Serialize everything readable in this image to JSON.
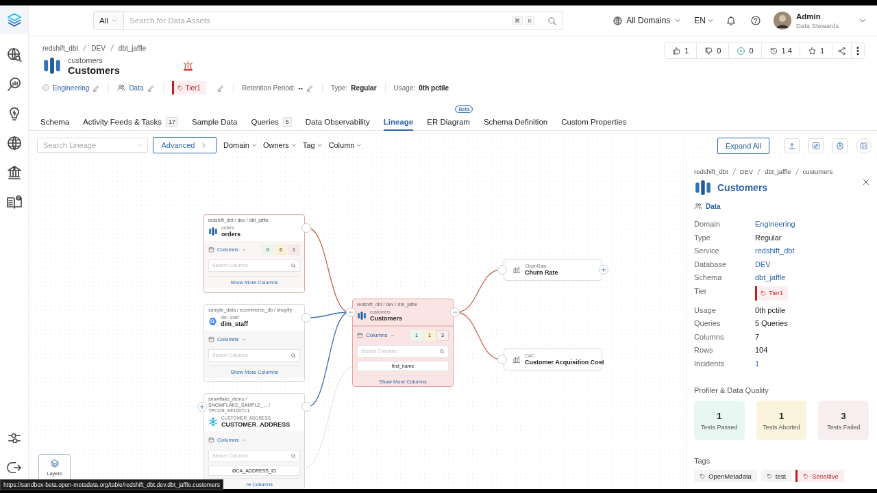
{
  "header": {
    "search_scope": "All",
    "search_placeholder": "Search for Data Assets",
    "shortcut_keys": [
      "⌘",
      "K"
    ],
    "domain": "All Domains",
    "language": "EN",
    "user": {
      "name": "Admin",
      "role": "Data Stewards"
    }
  },
  "breadcrumb": [
    "redshift_dbt",
    "DEV",
    "dbt_jaffle"
  ],
  "entity": {
    "name": "customers",
    "display_name": "Customers"
  },
  "actions": [
    {
      "kind": "like",
      "count": "1"
    },
    {
      "kind": "dislike",
      "count": "0"
    },
    {
      "kind": "watch",
      "count": "0"
    },
    {
      "kind": "version",
      "count": "1.4"
    },
    {
      "kind": "star",
      "count": "1"
    }
  ],
  "properties": {
    "domain": "Engineering",
    "owner": "Data",
    "tier": "Tier1",
    "fields": [
      {
        "label": "Retention Period:",
        "value": "--",
        "editable": true
      },
      {
        "label": "Type:",
        "value": "Regular",
        "editable": false
      },
      {
        "label": "Usage:",
        "value": "0th pctile",
        "editable": false
      }
    ]
  },
  "tabs": [
    {
      "label": "Schema",
      "selected": false
    },
    {
      "label": "Activity Feeds & Tasks",
      "count": "17",
      "selected": false
    },
    {
      "label": "Sample Data",
      "selected": false
    },
    {
      "label": "Queries",
      "count": "5",
      "selected": false
    },
    {
      "label": "Data Observability",
      "selected": false
    },
    {
      "label": "Lineage",
      "selected": true
    },
    {
      "label": "ER Diagram",
      "badge": "Beta",
      "selected": false
    },
    {
      "label": "Schema Definition",
      "selected": false
    },
    {
      "label": "Custom Properties",
      "selected": false
    }
  ],
  "lineage_toolbar": {
    "search_placeholder": "Search Lineage",
    "advanced": "Advanced",
    "filters": [
      "Domain",
      "Owners",
      "Tag",
      "Column"
    ],
    "expand_all": "Expand All"
  },
  "nodes": [
    {
      "kind": "table",
      "path": "redshift_dbt / dev / dbt_jaffle",
      "name": "orders",
      "display_name": "orders",
      "selected": false,
      "traced": true,
      "columns_label": "Columns",
      "column_counts": [
        "0",
        "6",
        "1"
      ],
      "search_placeholder": "Search Columns",
      "show_more": "Show More Columns"
    },
    {
      "kind": "table",
      "path": "sample_data / ecommerce_db / shopify",
      "name": "dim_staff",
      "display_name": "dim_staff",
      "selected": false,
      "traced": false,
      "columns_label": "Columns",
      "search_placeholder": "Search Columns",
      "show_more": "Show More Columns"
    },
    {
      "kind": "table",
      "path": "snowflake_demo / SNOWFLAKE_SAMPLE_... / TPCDS_SF100TCL",
      "name": "CUSTOMER_ADDRESS",
      "display_name": "CUSTOMER_ADDRESS",
      "selected": false,
      "traced": false,
      "columns_label": "Columns",
      "search_placeholder": "Search Columns",
      "columns": [
        {
          "name": "CA_ADDRESS_ID",
          "symbol": "Ø"
        }
      ],
      "show_more": "re Columns"
    },
    {
      "kind": "table",
      "path": "redshift_dbt / dev / dbt_jaffle",
      "name": "customers",
      "display_name": "Customers",
      "selected": true,
      "traced": false,
      "columns_label": "Columns",
      "column_counts": [
        "1",
        "1",
        "3"
      ],
      "search_placeholder": "Search Columns",
      "columns": [
        {
          "name": "first_name"
        }
      ],
      "show_more": "Show More Columns"
    },
    {
      "kind": "metric",
      "name": "ChurnRate",
      "display_name": "Churn Rate"
    },
    {
      "kind": "metric",
      "name": "CAC",
      "display_name": "Customer Acquisition Cost"
    }
  ],
  "edges": [
    {
      "kind": "table",
      "color": "#c4664d"
    },
    {
      "kind": "table",
      "color": "#3f6fae"
    },
    {
      "kind": "table",
      "color": "#3f6fae"
    },
    {
      "kind": "table",
      "color": "#c4664d"
    },
    {
      "kind": "table",
      "color": "#c4664d"
    },
    {
      "kind": "column",
      "color": "#e2e2e2"
    }
  ],
  "layers": "Layers",
  "panel": {
    "breadcrumb": [
      "redshift_dbt",
      "DEV",
      "dbt_jaffle",
      "customers"
    ],
    "title": "Customers",
    "owner": "Data",
    "details": [
      {
        "label": "Domain",
        "value": "Engineering",
        "kind": "link"
      },
      {
        "label": "Type",
        "value": "Regular",
        "kind": "text"
      },
      {
        "label": "Service",
        "value": "redshift_dbt",
        "kind": "link"
      },
      {
        "label": "Database",
        "value": "DEV",
        "kind": "link"
      },
      {
        "label": "Schema",
        "value": "dbt_jaffle",
        "kind": "link"
      },
      {
        "label": "Tier",
        "value": "Tier1",
        "kind": "tier"
      },
      {
        "label": "Usage",
        "value": "0th pctile",
        "kind": "text"
      },
      {
        "label": "Queries",
        "value": "5 Queries",
        "kind": "text"
      },
      {
        "label": "Columns",
        "value": "7",
        "kind": "text"
      },
      {
        "label": "Rows",
        "value": "104",
        "kind": "text"
      },
      {
        "label": "Incidents",
        "value": "1",
        "kind": "link"
      }
    ],
    "quality_title": "Profiler & Data Quality",
    "tests": [
      {
        "count": "1",
        "label": "Tests Passed",
        "kind": "passed"
      },
      {
        "count": "1",
        "label": "Tests Aborted",
        "kind": "aborted"
      },
      {
        "count": "3",
        "label": "Tests Failed",
        "kind": "failed"
      }
    ],
    "tags_title": "Tags",
    "tags": [
      {
        "label": "OpenMetadata",
        "kind": "plain"
      },
      {
        "label": "test",
        "kind": "plain"
      },
      {
        "label": "Sensitive",
        "kind": "classified"
      }
    ]
  },
  "status_url": "https://sandbox-beta.open-metadata.org/table/redshift_dbt.dev.dbt_jaffle.customers"
}
